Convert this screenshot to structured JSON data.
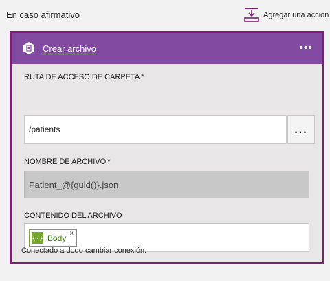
{
  "branch": {
    "label": "En caso afirmativo"
  },
  "toolbar": {
    "add_action_label": "Agregar una acción",
    "add_action_icon": "add-action-icon"
  },
  "card": {
    "title": "Crear archivo",
    "icon": "file-icon",
    "more_label": "•••",
    "header_color": "#824aa0",
    "border_color": "#7e1e74"
  },
  "fields": {
    "folder_path": {
      "label": "RUTA DE ACCESO DE CARPETA",
      "required_mark": "*",
      "value": "/patients",
      "browse_label": "..."
    },
    "file_name": {
      "label": "NOMBRE DE ARCHIVO",
      "required_mark": "*",
      "value": "Patient_@{guid()}.json"
    },
    "file_content": {
      "label": "CONTENIDO DEL ARCHIVO",
      "token_label": "Body",
      "token_icon": "curly-braces-icon",
      "token_color": "#74a62c",
      "token_remove": "×"
    }
  },
  "connection": {
    "text": "Conectado a dodo cambiar conexión."
  }
}
